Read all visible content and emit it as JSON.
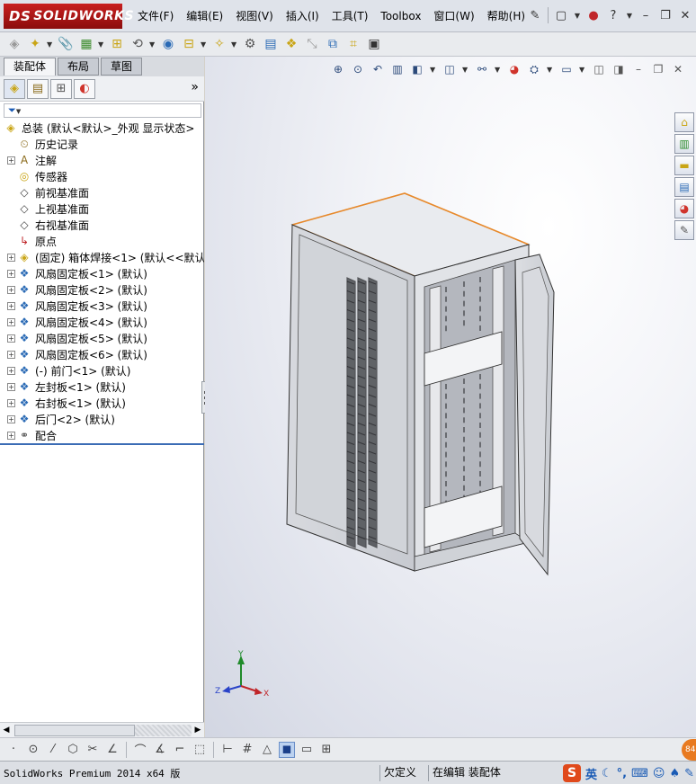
{
  "app": {
    "logo_text": "SOLIDWORKS",
    "logo_prefix": "DS",
    "brand_color": "#c82020"
  },
  "menu": [
    {
      "label": "文件(F)"
    },
    {
      "label": "编辑(E)"
    },
    {
      "label": "视图(V)"
    },
    {
      "label": "插入(I)"
    },
    {
      "label": "工具(T)"
    },
    {
      "label": "Toolbox"
    },
    {
      "label": "窗口(W)"
    },
    {
      "label": "帮助(H)"
    }
  ],
  "left_panel": {
    "tabs": [
      "装配体",
      "布局",
      "草图"
    ],
    "active_tab": "装配体",
    "more_glyph": "»",
    "filter_glyph": "▼",
    "tree": [
      {
        "label": "总装  (默认<默认>_外观 显示状态>",
        "icon": "assembly-icon",
        "expand": ""
      },
      {
        "label": "历史记录",
        "icon": "history-icon",
        "expand": ""
      },
      {
        "label": "注解",
        "icon": "annotation-icon",
        "expand": "+"
      },
      {
        "label": "传感器",
        "icon": "sensor-icon",
        "expand": ""
      },
      {
        "label": "前视基准面",
        "icon": "plane-icon",
        "expand": ""
      },
      {
        "label": "上视基准面",
        "icon": "plane-icon",
        "expand": ""
      },
      {
        "label": "右视基准面",
        "icon": "plane-icon",
        "expand": ""
      },
      {
        "label": "原点",
        "icon": "origin-icon",
        "expand": ""
      },
      {
        "label": "(固定) 箱体焊接<1> (默认<<默认",
        "icon": "part-icon",
        "expand": "+"
      },
      {
        "label": "风扇固定板<1> (默认)",
        "icon": "subassembly-icon",
        "expand": "+"
      },
      {
        "label": "风扇固定板<2> (默认)",
        "icon": "subassembly-icon",
        "expand": "+"
      },
      {
        "label": "风扇固定板<3> (默认)",
        "icon": "subassembly-icon",
        "expand": "+"
      },
      {
        "label": "风扇固定板<4> (默认)",
        "icon": "subassembly-icon",
        "expand": "+"
      },
      {
        "label": "风扇固定板<5> (默认)",
        "icon": "subassembly-icon",
        "expand": "+"
      },
      {
        "label": "风扇固定板<6> (默认)",
        "icon": "subassembly-icon",
        "expand": "+"
      },
      {
        "label": "(-) 前门<1> (默认)",
        "icon": "subassembly-icon",
        "expand": "+"
      },
      {
        "label": "左封板<1> (默认)",
        "icon": "subassembly-icon",
        "expand": "+"
      },
      {
        "label": "右封板<1> (默认)",
        "icon": "subassembly-icon",
        "expand": "+"
      },
      {
        "label": "后门<2> (默认)",
        "icon": "subassembly-icon",
        "expand": "+"
      },
      {
        "label": "配合",
        "icon": "mates-icon",
        "expand": "+"
      }
    ]
  },
  "graphics": {
    "triad": {
      "x_label": "X",
      "y_label": "Y",
      "z_label": "Z"
    },
    "edge_highlight_color": "#e8892a"
  },
  "statusbar": {
    "product": "SolidWorks Premium 2014 x64 版",
    "state": "欠定义",
    "mode": "在编辑 装配体",
    "ime_s": "S",
    "ime_lang": "英",
    "badge": "84"
  }
}
